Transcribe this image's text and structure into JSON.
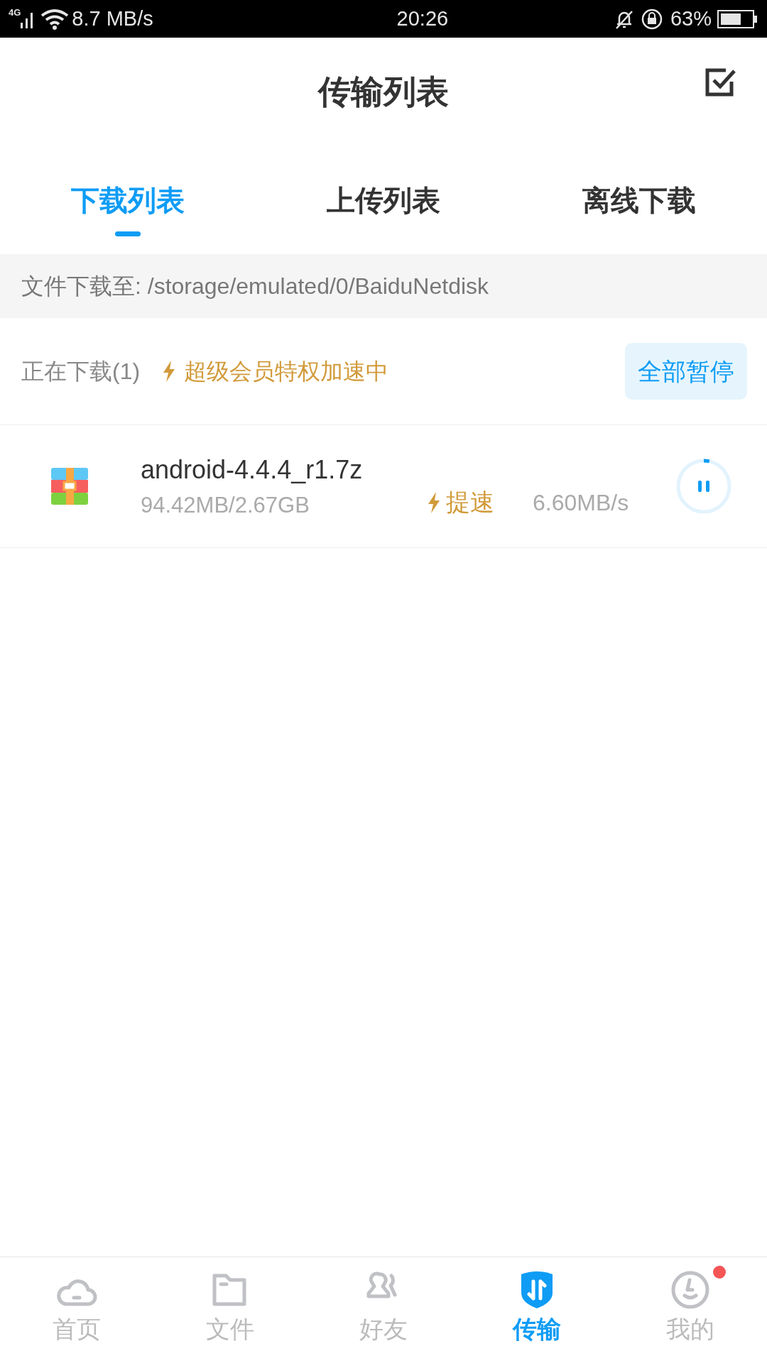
{
  "status_bar": {
    "network": "4G",
    "speed": "8.7 MB/s",
    "time": "20:26",
    "battery": "63%"
  },
  "header": {
    "title": "传输列表"
  },
  "tabs": [
    {
      "label": "下载列表",
      "selected": true
    },
    {
      "label": "上传列表",
      "selected": false
    },
    {
      "label": "离线下载",
      "selected": false
    }
  ],
  "path_bar": {
    "text": "文件下载至: /storage/emulated/0/BaiduNetdisk"
  },
  "section": {
    "title": "正在下载(1)",
    "vip_note": "超级会员特权加速中",
    "pause_all": "全部暂停"
  },
  "downloads": [
    {
      "name": "android-4.4.4_r1.7z",
      "size": "94.42MB/2.67GB",
      "boost": "提速",
      "speed": "6.60MB/s",
      "level": 0.035,
      "paused": false
    }
  ],
  "nav": [
    {
      "label": "首页",
      "kind": "cloud",
      "selected": false,
      "badge": false
    },
    {
      "label": "文件",
      "kind": "folder",
      "selected": false,
      "badge": false
    },
    {
      "label": "好友",
      "kind": "friends",
      "selected": false,
      "badge": false
    },
    {
      "label": "传输",
      "kind": "transfer",
      "selected": true,
      "badge": false
    },
    {
      "label": "我的",
      "kind": "me",
      "selected": false,
      "badge": true
    }
  ]
}
